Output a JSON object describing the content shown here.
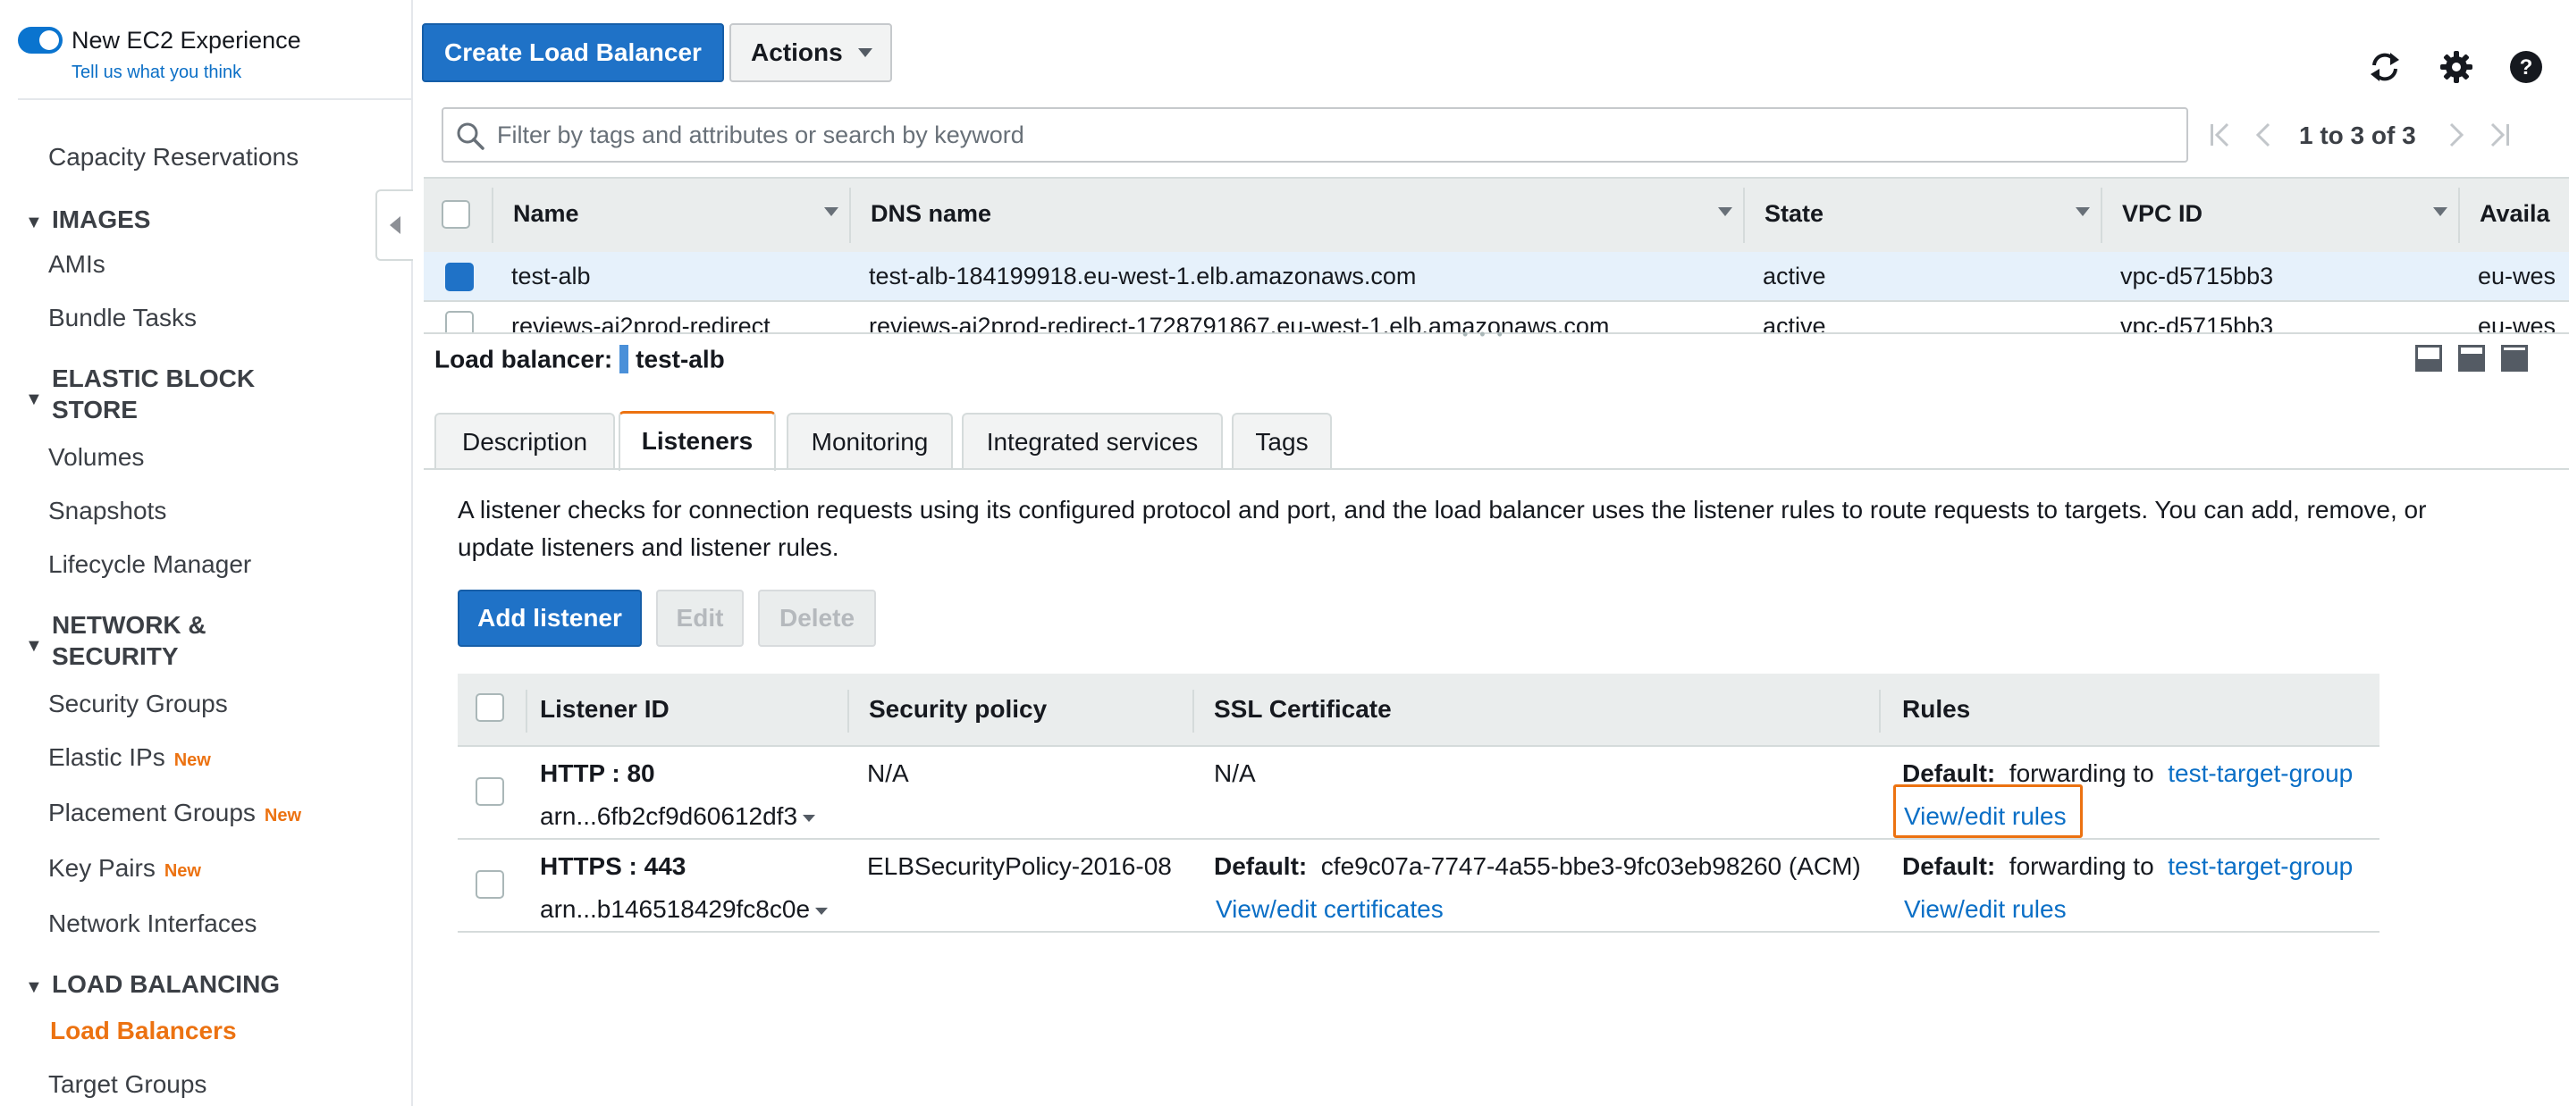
{
  "sidebar": {
    "toggle_label": "New EC2 Experience",
    "feedback_link": "Tell us what you think",
    "capacity_reservations": "Capacity Reservations",
    "sections": {
      "images": "IMAGES",
      "ebs": "ELASTIC BLOCK STORE",
      "network": "NETWORK & SECURITY",
      "load_balancing": "LOAD BALANCING"
    },
    "items": {
      "amis": "AMIs",
      "bundle_tasks": "Bundle Tasks",
      "volumes": "Volumes",
      "snapshots": "Snapshots",
      "lifecycle_manager": "Lifecycle Manager",
      "security_groups": "Security Groups",
      "elastic_ips": "Elastic IPs",
      "placement_groups": "Placement Groups",
      "key_pairs": "Key Pairs",
      "network_interfaces": "Network Interfaces",
      "load_balancers": "Load Balancers",
      "target_groups": "Target Groups"
    },
    "new_badge": "New"
  },
  "toolbar": {
    "create_label": "Create Load Balancer",
    "actions_label": "Actions"
  },
  "search": {
    "placeholder": "Filter by tags and attributes or search by keyword"
  },
  "pagination": {
    "text": "1 to 3 of 3"
  },
  "table": {
    "columns": [
      "Name",
      "DNS name",
      "State",
      "VPC ID",
      "Availa"
    ],
    "rows": [
      [
        "test-alb",
        "test-alb-184199918.eu-west-1.elb.amazonaws.com",
        "active",
        "vpc-d5715bb3",
        "eu-wes"
      ],
      [
        "reviews-ai2prod-redirect",
        "reviews-ai2prod-redirect-1728791867.eu-west-1.elb.amazonaws.com",
        "active",
        "vpc-d5715bb3",
        "eu-wes"
      ]
    ]
  },
  "details": {
    "lb_label": "Load balancer:",
    "lb_name": "test-alb",
    "tabs": [
      "Description",
      "Listeners",
      "Monitoring",
      "Integrated services",
      "Tags"
    ],
    "description": "A listener checks for connection requests using its configured protocol and port, and the load balancer uses the listener rules to route requests to targets. You can add, remove, or update listeners and listener rules.",
    "add_listener": "Add listener",
    "edit": "Edit",
    "delete": "Delete"
  },
  "listeners": {
    "columns": [
      "Listener ID",
      "Security policy",
      "SSL Certificate",
      "Rules"
    ],
    "rows": [
      {
        "id": "HTTP : 80",
        "arn": "arn...6fb2cf9d60612df3",
        "policy": "N/A",
        "cert": "N/A",
        "cert_link": "",
        "default_label": "Default:",
        "forwarding": "forwarding to",
        "target": "test-target-group",
        "rules_link": "View/edit rules"
      },
      {
        "id": "HTTPS : 443",
        "arn": "arn...b146518429fc8c0e",
        "policy": "ELBSecurityPolicy-2016-08",
        "cert_default": "Default:",
        "cert": "cfe9c07a-7747-4a55-bbe3-9fc03eb98260 (ACM)",
        "cert_link": "View/edit certificates",
        "default_label": "Default:",
        "forwarding": "forwarding to",
        "target": "test-target-group",
        "rules_link": "View/edit rules"
      }
    ]
  },
  "colors": {
    "primary": "#1f72c7",
    "accent": "#ec7211",
    "link": "#0b6fc6"
  }
}
